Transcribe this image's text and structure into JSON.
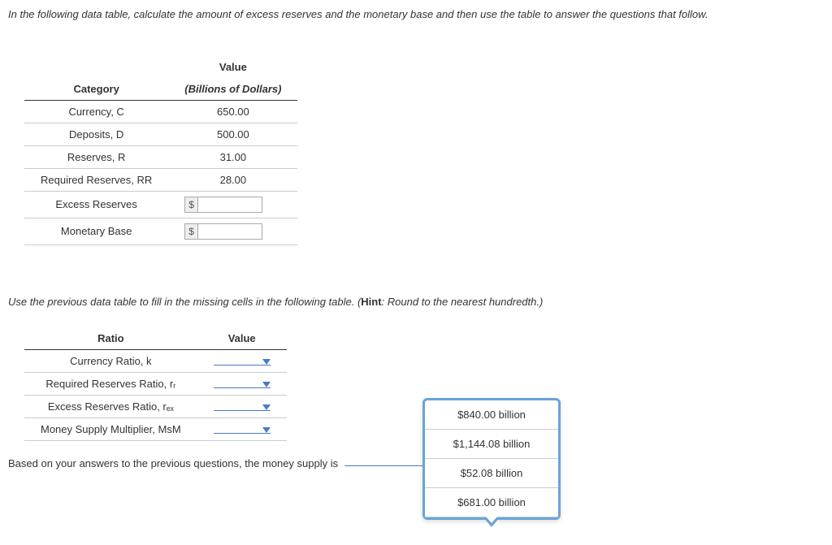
{
  "intro": "In the following data table, calculate the amount of excess reserves and the monetary base and then use the table to answer the questions that follow.",
  "table1": {
    "headers": {
      "col1": "Category",
      "col2_line1": "Value",
      "col2_line2": "(Billions of Dollars)"
    },
    "rows": [
      {
        "label": "Currency, C",
        "value": "650.00"
      },
      {
        "label": "Deposits, D",
        "value": "500.00"
      },
      {
        "label": "Reserves, R",
        "value": "31.00"
      },
      {
        "label": "Required Reserves, RR",
        "value": "28.00"
      }
    ],
    "input_rows": [
      {
        "label": "Excess Reserves",
        "prefix": "$"
      },
      {
        "label": "Monetary Base",
        "prefix": "$"
      }
    ]
  },
  "mid_instruction_pre": "Use the previous data table to fill in the missing cells in the following table. (",
  "mid_instruction_hint": "Hint",
  "mid_instruction_post": ": Round to the nearest hundredth.)",
  "table2": {
    "headers": {
      "col1": "Ratio",
      "col2": "Value"
    },
    "rows": [
      {
        "label": "Currency Ratio, k"
      },
      {
        "label": "Required Reserves Ratio, rᵣ"
      },
      {
        "label": "Excess Reserves Ratio, rₑₓ"
      },
      {
        "label": "Money Supply Multiplier, MsM"
      }
    ]
  },
  "popup_options": [
    "$840.00 billion",
    "$1,144.08 billion",
    "$52.08 billion",
    "$681.00 billion"
  ],
  "final_text_pre": "Based on your answers to the previous questions, the money supply is",
  "final_text_post": "."
}
